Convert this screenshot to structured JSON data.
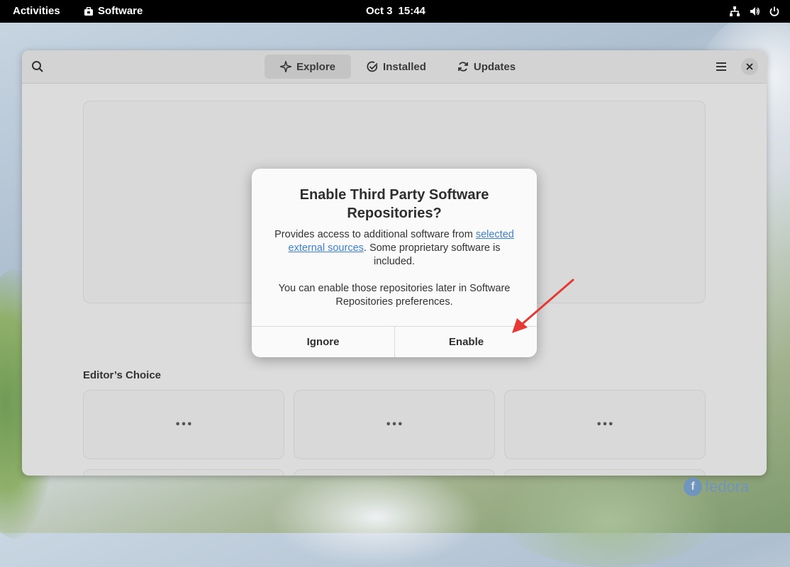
{
  "topbar": {
    "activities": "Activities",
    "app_name": "Software",
    "date": "Oct 3",
    "time": "15:44",
    "icons": [
      "network-icon",
      "volume-icon",
      "power-icon"
    ]
  },
  "window": {
    "tabs": [
      {
        "label": "Explore",
        "icon": "sparkle-icon",
        "active": true
      },
      {
        "label": "Installed",
        "icon": "check-circle-icon",
        "active": false
      },
      {
        "label": "Updates",
        "icon": "refresh-icon",
        "active": false
      }
    ],
    "section_title": "Editor’s Choice",
    "card_placeholder": "•••"
  },
  "dialog": {
    "title": "Enable Third Party Software Repositories?",
    "body_prefix": "Provides access to additional software from ",
    "body_link": "selected external sources",
    "body_suffix": ". Some proprietary software is included.",
    "body_note": "You can enable those repositories later in Software Repositories preferences.",
    "ignore_label": "Ignore",
    "enable_label": "Enable"
  },
  "wallpaper": {
    "brand": "fedora",
    "logo_glyph": "f"
  },
  "colors": {
    "accent_link": "#3f7fd2",
    "annotation_arrow": "#e53935"
  }
}
